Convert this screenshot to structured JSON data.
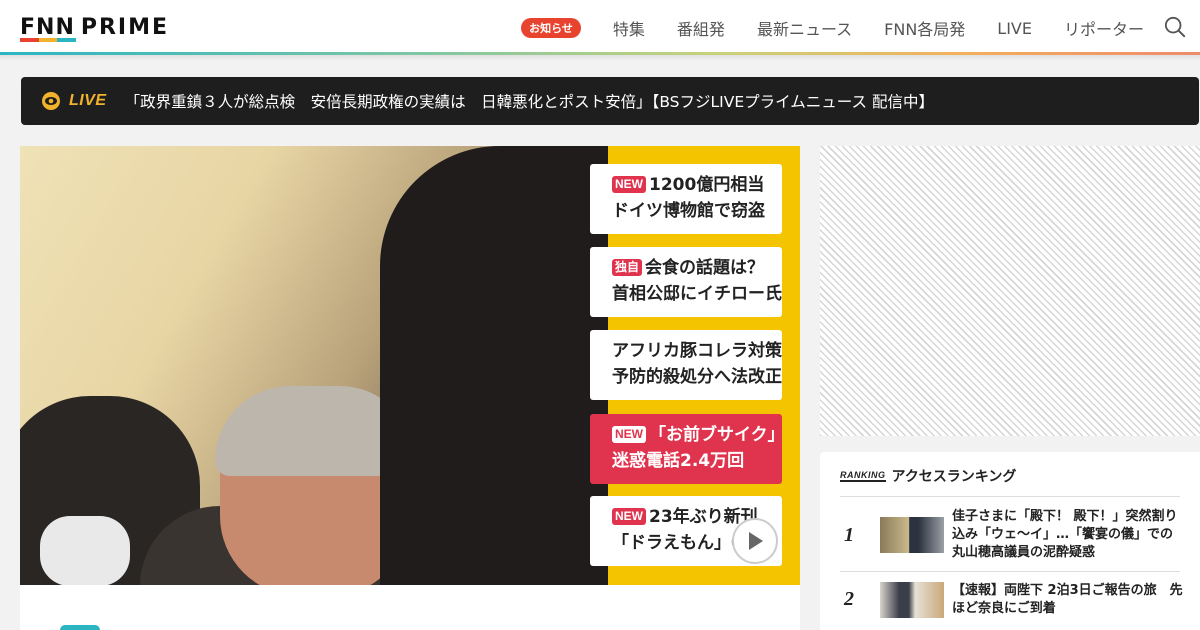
{
  "header": {
    "logo_fnn": "FNN",
    "logo_prime": "PRIME",
    "logo_colors": [
      "#e8432e",
      "#f1b32c",
      "#2bb5c3"
    ],
    "nav_badge": "お知らせ",
    "nav_items": [
      "特集",
      "番組発",
      "最新ニュース",
      "FNN各局発",
      "LIVE",
      "リポーター"
    ]
  },
  "live": {
    "label": "LIVE",
    "text": "「政界重鎮３人が総点検　安倍長期政権の実績は　日韓悪化とポスト安倍」【BSフジLIVEプライムニュース 配信中】",
    "accent": "#f1b32c"
  },
  "hero": {
    "headlines": [
      {
        "tag": "NEW",
        "line1": "1200億円相当",
        "line2": "ドイツ博物館で窃盗",
        "style": "white"
      },
      {
        "tag": "独自",
        "line1": "会食の話題は？",
        "line2": "首相公邸にイチロー氏",
        "style": "white"
      },
      {
        "tag": "",
        "line1": "アフリカ豚コレラ対策",
        "line2": "予防的殺処分へ法改正",
        "style": "white"
      },
      {
        "tag": "NEW",
        "line1": "「お前ブサイク」",
        "line2": "迷惑電話2.4万回",
        "style": "red"
      },
      {
        "tag": "NEW",
        "line1": "23年ぶり新刊",
        "line2": "「ドラえもん」0巻発",
        "style": "white"
      }
    ]
  },
  "ranking": {
    "badge": "RANKING",
    "title": "アクセスランキング",
    "items": [
      {
        "rank": "1",
        "text": "佳子さまに「殿下！ 殿下！」突然割り込み「ウェ～イ」…「饗宴の儀」での丸山穂高議員の泥酔疑惑"
      },
      {
        "rank": "2",
        "text": "【速報】両陛下 2泊3日ご報告の旅　先ほど奈良にご到着"
      }
    ]
  }
}
